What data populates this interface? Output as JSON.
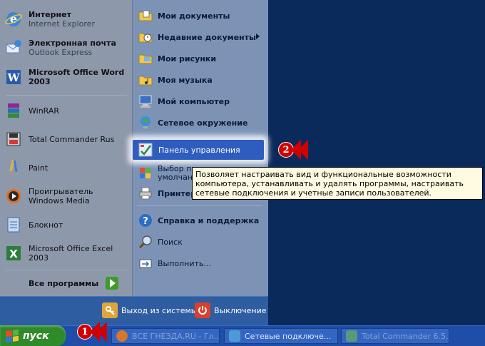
{
  "left_items": [
    {
      "title": "Интернет",
      "subtitle": "Internet Explorer",
      "icon": "internet-explorer-icon"
    },
    {
      "title": "Электронная почта",
      "subtitle": "Outlook Express",
      "icon": "outlook-express-icon"
    },
    {
      "title": "Microsoft Office Word 2003",
      "icon": "word-icon"
    },
    {
      "title": "WinRAR",
      "icon": "winrar-icon"
    },
    {
      "title": "Total Commander Rus",
      "icon": "total-commander-icon"
    },
    {
      "title": "Paint",
      "icon": "paint-icon"
    },
    {
      "title": "Проигрыватель Windows Media",
      "icon": "media-player-icon"
    },
    {
      "title": "Блокнот",
      "icon": "notepad-icon"
    },
    {
      "title": "Microsoft Office Excel 2003",
      "icon": "excel-icon"
    }
  ],
  "all_programs": "Все программы",
  "right_items": {
    "my_documents": "Мои документы",
    "recent_documents": "Недавние документы",
    "my_pictures": "Мои рисунки",
    "my_music": "Моя музыка",
    "my_computer": "Мой компьютер",
    "network": "Сетевое окружение",
    "control_panel": "Панель управления",
    "set_program_access_1": "Выбор пр",
    "set_program_access_2": "умолчан",
    "printers": "Принтеры",
    "help": "Справка и поддержка",
    "search": "Поиск",
    "run": "Выполнить..."
  },
  "tooltip": "Позволяет настраивать вид и функциональные возможности компьютера, устанавливать и удалять программы,  настраивать сетевые подключения и учетные записи пользователей.",
  "markers": {
    "one": "1",
    "two": "2"
  },
  "bottom": {
    "logoff": "Выход из системы",
    "shutdown": "Выключение"
  },
  "taskbar": {
    "start": "пуск",
    "tasks": [
      {
        "label": "ВСЕ ГНЕЗДА.RU - Гл...",
        "icon": "firefox-icon"
      },
      {
        "label": "Сетевые подключе...",
        "icon": "network-connections-icon"
      },
      {
        "label": "Total Commander 6.5...",
        "icon": "total-commander-icon"
      }
    ]
  },
  "colors": {
    "accent": "#2f5dbf",
    "start_green": "#2f8a2a",
    "marker_red": "#d10000"
  }
}
